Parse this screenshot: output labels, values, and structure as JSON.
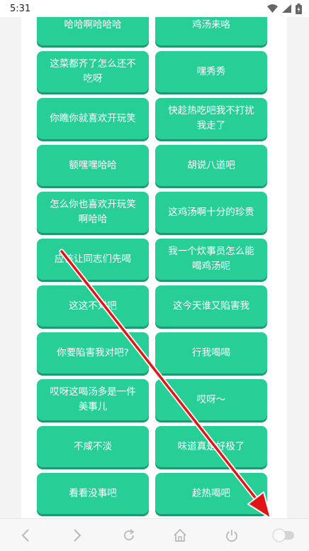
{
  "status_bar": {
    "time": "5:31",
    "icons": [
      "wifi-icon",
      "signal-icon",
      "battery-charging-icon"
    ]
  },
  "buttons": [
    {
      "label": "哈哈啊哈哈哈"
    },
    {
      "label": "鸡汤来咯"
    },
    {
      "label": "这菜都齐了怎么还不吃呀"
    },
    {
      "label": "嘿秀秀"
    },
    {
      "label": "你瞧你就喜欢开玩笑"
    },
    {
      "label": "快趁热吃吧我不打扰我走了"
    },
    {
      "label": "额嘿嘿哈哈"
    },
    {
      "label": "胡说八道吧"
    },
    {
      "label": "怎么你也喜欢开玩笑啊哈哈"
    },
    {
      "label": "这鸡汤啊十分的珍贵"
    },
    {
      "label": "应该让同志们先喝"
    },
    {
      "label": "我一个炊事员怎么能喝鸡汤呢"
    },
    {
      "label": "这这不对吧"
    },
    {
      "label": "这今天谁又陷害我"
    },
    {
      "label": "你要陷害我对吧?"
    },
    {
      "label": "行我喝喝"
    },
    {
      "label": "哎呀这喝汤多是一件美事儿"
    },
    {
      "label": "哎呀～"
    },
    {
      "label": "不咸不淡"
    },
    {
      "label": "味道真是好极了"
    },
    {
      "label": "看看没事吧"
    },
    {
      "label": "趁热喝吧"
    }
  ],
  "nav_bar": {
    "items": [
      "back-icon",
      "forward-icon",
      "refresh-icon",
      "home-icon",
      "power-icon",
      "toggle-switch"
    ]
  },
  "colors": {
    "tile": "#27cf97",
    "tile_shadow": "#1c9a70",
    "arrow": "#e01515"
  }
}
